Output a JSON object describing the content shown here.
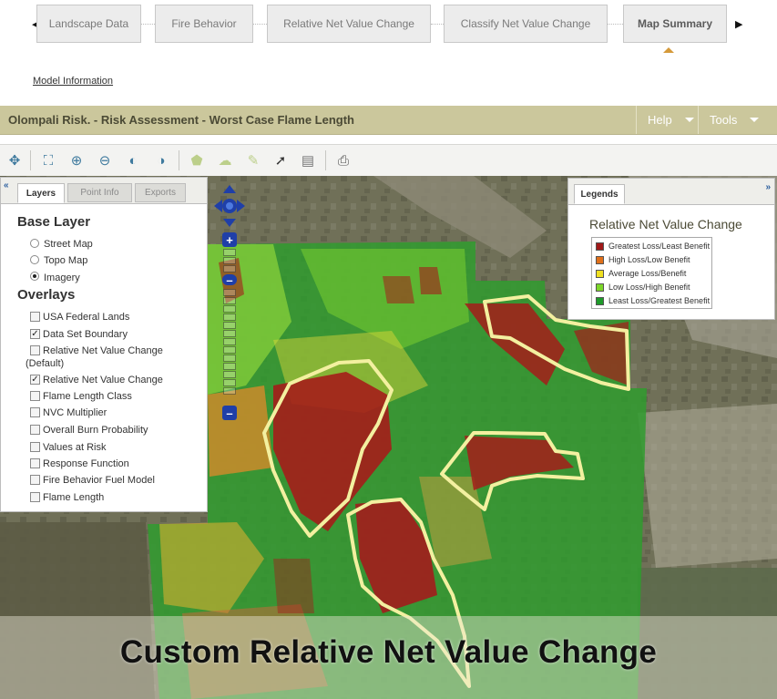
{
  "wizard": {
    "steps": [
      {
        "label": "Landscape Data"
      },
      {
        "label": "Fire Behavior"
      },
      {
        "label": "Relative Net Value Change"
      },
      {
        "label": "Classify Net Value Change"
      },
      {
        "label": "Map Summary"
      }
    ],
    "active_step": "Map Summary",
    "model_info_link": "Model Information"
  },
  "titlebar": {
    "title": "Olompali Risk. - Risk Assessment - Worst Case Flame Length",
    "help_label": "Help",
    "tools_label": "Tools"
  },
  "toolbar": {
    "tools": [
      "pan-icon",
      "zoom-extent-icon",
      "zoom-in-icon",
      "zoom-out-icon",
      "zoom-previous-icon",
      "zoom-next-icon",
      "draw-polygon-icon",
      "draw-shape-icon",
      "edit-polygon-icon",
      "identify-icon",
      "attribute-table-icon",
      "export-icon"
    ]
  },
  "left_panel": {
    "tabs": [
      "Layers",
      "Point Info",
      "Exports"
    ],
    "active_tab": "Layers",
    "base_layer_title": "Base Layer",
    "base_layers": [
      {
        "label": "Street Map",
        "selected": false
      },
      {
        "label": "Topo Map",
        "selected": false
      },
      {
        "label": "Imagery",
        "selected": true
      }
    ],
    "overlays_title": "Overlays",
    "overlays": [
      {
        "label": "USA Federal Lands",
        "checked": false
      },
      {
        "label": "Data Set Boundary",
        "checked": true
      },
      {
        "label": "Relative Net Value Change",
        "label2": "(Default)",
        "checked": false
      },
      {
        "label": "Relative Net Value Change",
        "checked": true
      },
      {
        "label": "Flame Length Class",
        "checked": false
      },
      {
        "label": "NVC Multiplier",
        "checked": false
      },
      {
        "label": "Overall Burn Probability",
        "checked": false
      },
      {
        "label": "Values at Risk",
        "checked": false
      },
      {
        "label": "Response Function",
        "checked": false
      },
      {
        "label": "Fire Behavior Fuel Model",
        "checked": false
      },
      {
        "label": "Flame Length",
        "checked": false
      }
    ]
  },
  "legend_panel": {
    "tab": "Legends",
    "title": "Relative Net Value Change",
    "items": [
      {
        "label": "Greatest Loss/Least Benefit",
        "color": "#a01818"
      },
      {
        "label": "High Loss/Low Benefit",
        "color": "#e0701a"
      },
      {
        "label": "Average Loss/Benefit",
        "color": "#f0e020"
      },
      {
        "label": "Low Loss/High Benefit",
        "color": "#7cd62a"
      },
      {
        "label": "Least Loss/Greatest Benefit",
        "color": "#1e9a2a"
      }
    ]
  },
  "caption": "Custom Relative Net Value Change",
  "colors": {
    "titlebar_bg": "#cbc79c",
    "highlight_outline": "#f3f0a0",
    "active_caret": "#d59a3a"
  }
}
